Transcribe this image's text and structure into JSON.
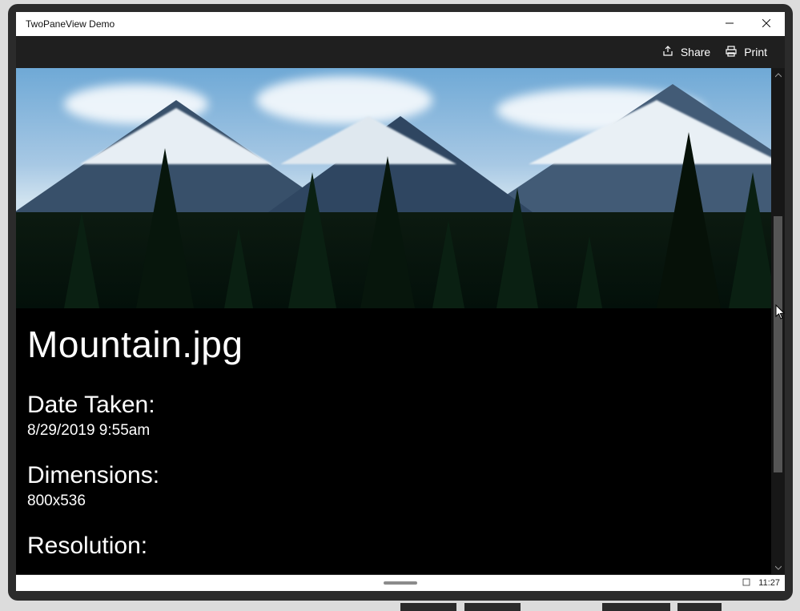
{
  "window": {
    "title": "TwoPaneView Demo"
  },
  "commandbar": {
    "share_label": "Share",
    "print_label": "Print"
  },
  "details": {
    "filename": "Mountain.jpg",
    "date_label": "Date Taken:",
    "date_value": "8/29/2019 9:55am",
    "dimensions_label": "Dimensions:",
    "dimensions_value": "800x536",
    "resolution_label": "Resolution:"
  },
  "statusbar": {
    "clock": "11:27"
  }
}
